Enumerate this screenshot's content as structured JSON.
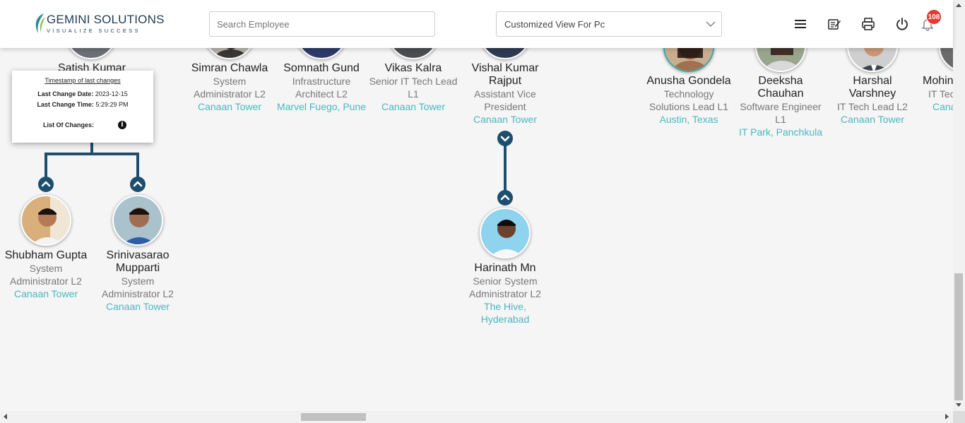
{
  "header": {
    "logo_title": "GEMINI SOLUTIONS",
    "logo_subtitle": "VISUALIZE SUCCESS",
    "search_placeholder": "Search Employee",
    "view_select_value": "Customized View For Pc",
    "notification_count": "108",
    "icons": [
      "menu-icon",
      "edit-note-icon",
      "print-icon",
      "power-icon",
      "bell-icon"
    ]
  },
  "tooltip": {
    "heading": "Timestamp of last changes",
    "date_label": "Last Change Date:",
    "date_value": "2023-12-15",
    "time_label": "Last Change Time:",
    "time_value": "5:29:29 PM",
    "changes_label": "List Of Changes:"
  },
  "top_row": [
    {
      "name": "Satish Kumar",
      "title": "",
      "location": ""
    },
    {
      "name": "Simran Chawla",
      "title": "System Administrator L2",
      "location": "Canaan Tower"
    },
    {
      "name": "Somnath Gund",
      "title": "Infrastructure Architect L2",
      "location": "Marvel Fuego, Pune"
    },
    {
      "name": "Vikas Kalra",
      "title": "Senior IT Tech Lead L1",
      "location": "Canaan Tower"
    },
    {
      "name": "Vishal Kumar Rajput",
      "title": "Assistant Vice President",
      "location": "Canaan Tower"
    },
    {
      "name": "Anusha Gondela",
      "title": "Technology Solutions Lead L1",
      "location": "Austin, Texas"
    },
    {
      "name": "Deeksha Chauhan",
      "title": "Software Engineer L1",
      "location": "IT Park, Panchkula"
    },
    {
      "name": "Harshal Varshney",
      "title": "IT Tech Lead L2",
      "location": "Canaan Tower"
    },
    {
      "name": "Mohin",
      "title": "IT Tec",
      "location": "Cana"
    }
  ],
  "children": [
    {
      "name": "Shubham Gupta",
      "title": "System Administrator L2",
      "location": "Canaan Tower"
    },
    {
      "name": "Srinivasarao Mupparti",
      "title": "System Administrator L2",
      "location": "Canaan Tower"
    },
    {
      "name": "Harinath Mn",
      "title": "Senior System Administrator L2",
      "location": "The Hive, Hyderabad"
    }
  ],
  "colors": {
    "accent": "#1e4e6e",
    "location_text": "#48b8bf",
    "badge": "#e53935"
  }
}
